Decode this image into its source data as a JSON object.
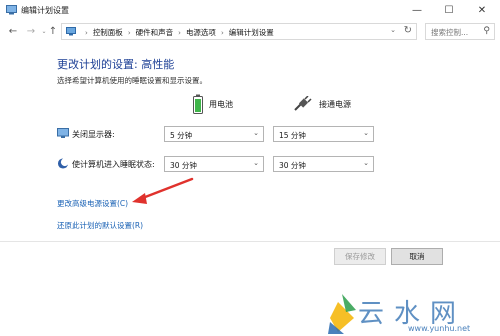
{
  "window": {
    "title": "编辑计划设置",
    "minimize": "—",
    "maximize": "☐",
    "close": "✕"
  },
  "nav": {
    "back": "←",
    "forward": "→",
    "recent": "⌄",
    "up": "↑",
    "breadcrumbs": [
      "控制面板",
      "硬件和声音",
      "电源选项",
      "编辑计划设置"
    ],
    "separator": "›",
    "search_placeholder": "搜索控制...",
    "search_icon": "⚲",
    "refresh": "↻",
    "dropdown": "⌄"
  },
  "main": {
    "title": "更改计划的设置: 高性能",
    "description": "选择希望计算机使用的睡眠设置和显示设置。",
    "columns": {
      "battery": "用电池",
      "plugged": "接通电源"
    },
    "rows": [
      {
        "label": "关闭显示器:",
        "icon": "monitor-icon",
        "battery_value": "5 分钟",
        "plugged_value": "15 分钟"
      },
      {
        "label": "使计算机进入睡眠状态:",
        "icon": "moon-icon",
        "battery_value": "30 分钟",
        "plugged_value": "30 分钟"
      }
    ],
    "select_arrow": "⌄",
    "links": {
      "advanced": "更改高级电源设置(C)",
      "restore": "还原此计划的默认设置(R)"
    }
  },
  "footer": {
    "save": "保存修改",
    "cancel": "取消"
  },
  "watermark": {
    "text": "云水网",
    "url": "www.yunhu.net"
  },
  "colors": {
    "title_blue": "#1c3f95",
    "link_blue": "#1a62b5",
    "annotation_red": "#e0322d",
    "battery_green": "#3fb54a"
  }
}
